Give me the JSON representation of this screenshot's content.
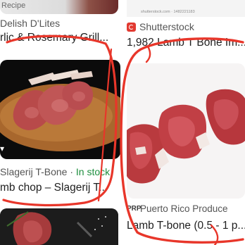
{
  "top_left": {
    "tag": "Recipe"
  },
  "top_right": {
    "caption": "shutterstock.com · 1482221183"
  },
  "left_card": {
    "source": "Delish D'Lites",
    "title": "rlic & Rosemary Grill..."
  },
  "right_card": {
    "source": "Shutterstock",
    "title": "1,982 Lamb T Bone Im..."
  },
  "left_result": {
    "store": "Slagerij T-Bone · ",
    "stock": "In stock",
    "name": "mb chop – Slagerij T..."
  },
  "right_result": {
    "logo_text": "PRP",
    "store": "Puerto Rico Produce",
    "name": "Lamb T-bone (0.5 - 1 p..."
  },
  "icons": {
    "shutterstock": "shutterstock-logo-icon",
    "badge": "image-badge-icon"
  },
  "colors": {
    "annotation": "#e8362a",
    "in_stock": "#1e8e3e",
    "shutterstock_brand": "#e23a31"
  }
}
